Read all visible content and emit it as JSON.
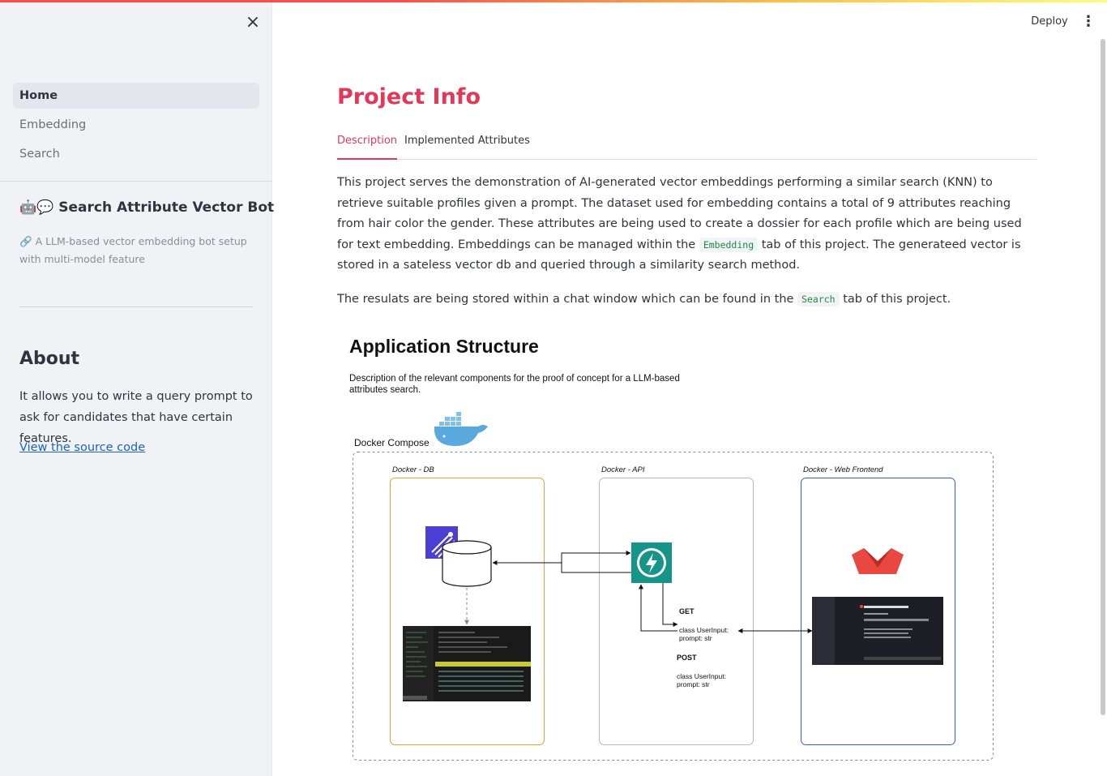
{
  "sidebar": {
    "close_label": "×",
    "nav_items": [
      {
        "label": "Home",
        "active": true
      },
      {
        "label": "Embedding",
        "active": false
      },
      {
        "label": "Search",
        "active": false
      }
    ],
    "bot_title_emoji": "🤖💬",
    "bot_title": "Search Attribute Vector Bot",
    "bot_desc_emoji": "🔗",
    "bot_desc": "A LLM-based vector embedding bot setup with multi-model feature",
    "about_title": "About",
    "about_text": "It allows you to write a query prompt to ask for candidates that have certain features.",
    "source_link": "View the source code"
  },
  "header": {
    "deploy_label": "Deploy",
    "menu_label": "⋮"
  },
  "main": {
    "title": "Project Info",
    "tabs": [
      {
        "label": "Description",
        "active": true
      },
      {
        "label": "Implemented Attributes",
        "active": false
      }
    ],
    "paragraph1_a": "This project serves the demonstration of AI-generated vector embeddings performing a similar search (KNN) to retrieve suitable profiles given a prompt. The dataset used for embedding contains a total of 9 attributes reaching from hair color the gender. These attributes are being used to create a dossier for each profile which are being used for text embedding. Embeddings can be managed within the",
    "paragraph1_code": "Embedding",
    "paragraph1_b": "tab of this project. The generateed vector is stored in a sateless vector db and queried through a similarity search method.",
    "paragraph2_a": "The resulats are being stored within a chat window which can be found in the",
    "paragraph2_code": "Search",
    "paragraph2_b": "tab of this project."
  },
  "diagram": {
    "title": "Application Structure",
    "subtitle": "Description of the relevant components for the proof of concept for a LLM-based attributes search.",
    "compose_label": "Docker Compose",
    "db_label": "Docker - DB",
    "api_label": "Docker - API",
    "web_label": "Docker - Web Frontend",
    "get_label": "GET",
    "get_class": "class UserInput:",
    "get_field": "prompt: str",
    "post_label": "POST",
    "post_class": "class UserInput:",
    "post_field": "prompt: str",
    "colors": {
      "db_border": "#e0a23a",
      "api_border": "#b8b8b8",
      "web_border": "#2f5fcf",
      "fastapi": "#159488",
      "qdrant": "#4b3fd6",
      "streamlit": "#e8483f",
      "docker": "#3c9ad8"
    }
  },
  "theme": {
    "accent": "#e0395a",
    "sidebar_bg": "#f0f2f6",
    "link": "#1c64b8"
  }
}
